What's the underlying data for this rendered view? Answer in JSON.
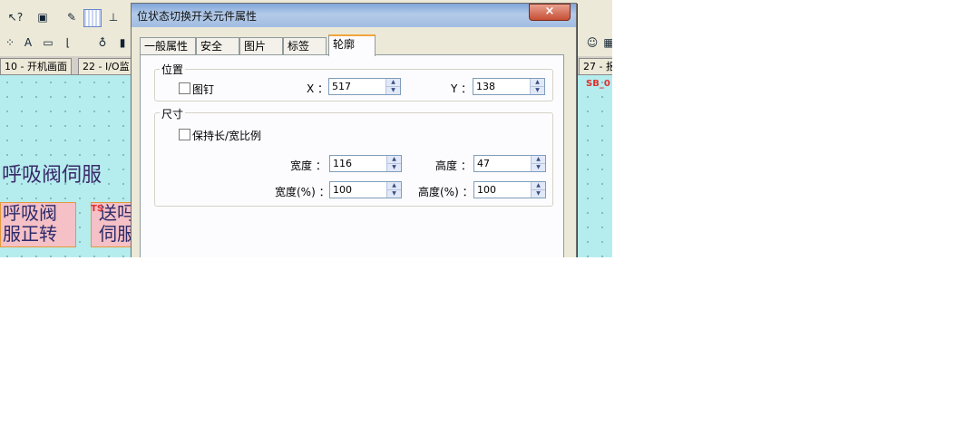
{
  "editor": {
    "window_tabs": [
      "10 - 开机画面",
      "22 - I/O监",
      "27 - 报"
    ],
    "canvas_texts": {
      "big_label": "呼吸阀伺服",
      "button1_line1": "呼吸阀",
      "button1_line2": "服正转",
      "button2_line1": "送吗",
      "button2_line2": "伺服",
      "tag_ts": "TS",
      "tag_sb": "SB_0"
    }
  },
  "dialog": {
    "title": "位状态切换开关元件属性",
    "close_glyph": "×",
    "tabs": [
      "一般属性",
      "安全",
      "图片",
      "标签",
      "轮廓"
    ],
    "active_tab": "轮廓",
    "position_group": {
      "label": "位置",
      "pin_label": "图钉",
      "pin_checked": false,
      "x_label": "X ：",
      "x_value": "517",
      "y_label": "Y ：",
      "y_value": "138"
    },
    "size_group": {
      "label": "尺寸",
      "keep_ratio_label": "保持长/宽比例",
      "keep_ratio_checked": false,
      "width_label": "宽度 ：",
      "width_value": "116",
      "height_label": "高度 ：",
      "height_value": "47",
      "width_pct_label": "宽度(%) ：",
      "width_pct_value": "100",
      "height_pct_label": "高度(%) ：",
      "height_pct_value": "100"
    }
  }
}
